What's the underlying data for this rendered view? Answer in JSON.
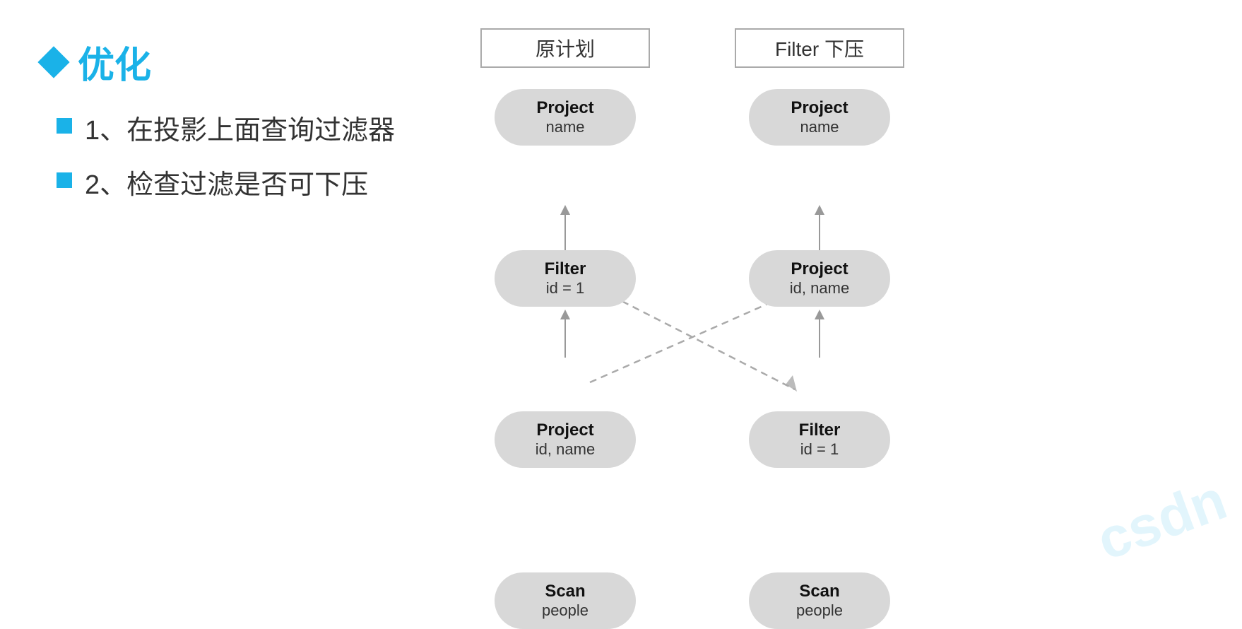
{
  "title": "优化",
  "bullets": [
    "1、在投影上面查询过滤器",
    "2、检查过滤是否可下压"
  ],
  "left_label": "原计划",
  "right_label": "Filter 下压",
  "left_nodes": [
    {
      "title": "Project",
      "sub": "name"
    },
    {
      "title": "Filter",
      "sub": "id = 1"
    },
    {
      "title": "Project",
      "sub": "id, name"
    },
    {
      "title": "Scan",
      "sub": "people"
    }
  ],
  "right_nodes": [
    {
      "title": "Project",
      "sub": "name"
    },
    {
      "title": "Project",
      "sub": "id, name"
    },
    {
      "title": "Filter",
      "sub": "id = 1"
    },
    {
      "title": "Scan",
      "sub": "people"
    }
  ]
}
